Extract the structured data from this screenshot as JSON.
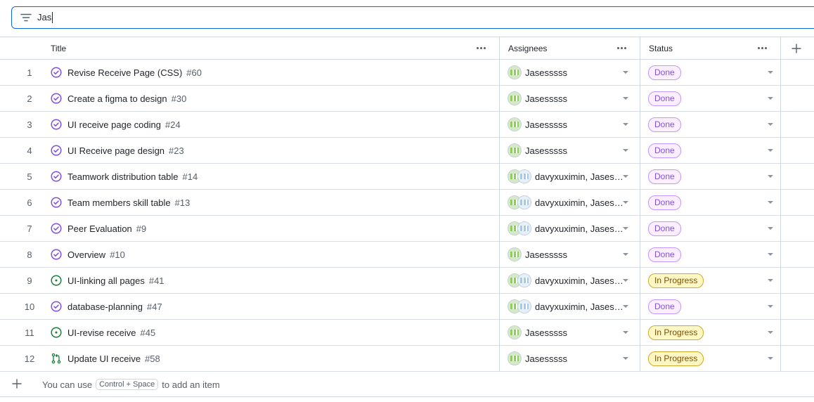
{
  "filter": {
    "value": "Jas",
    "icon": "filter-icon"
  },
  "columns": {
    "title": "Title",
    "assignees": "Assignees",
    "status": "Status"
  },
  "rows": [
    {
      "num": "1",
      "title": "Revise Receive Page (CSS)",
      "issue": "#60",
      "icon": "done",
      "assignee": "Jasesssss",
      "multi": false,
      "status": "Done"
    },
    {
      "num": "2",
      "title": "Create a figma to design",
      "issue": "#30",
      "icon": "done",
      "assignee": "Jasesssss",
      "multi": false,
      "status": "Done"
    },
    {
      "num": "3",
      "title": "UI receive page coding",
      "issue": "#24",
      "icon": "done",
      "assignee": "Jasesssss",
      "multi": false,
      "status": "Done"
    },
    {
      "num": "4",
      "title": "UI Receive page design",
      "issue": "#23",
      "icon": "done",
      "assignee": "Jasesssss",
      "multi": false,
      "status": "Done"
    },
    {
      "num": "5",
      "title": "Teamwork distribution table",
      "issue": "#14",
      "icon": "done",
      "assignee": "davyxuximin, Jasesssss",
      "multi": true,
      "status": "Done"
    },
    {
      "num": "6",
      "title": "Team members skill table",
      "issue": "#13",
      "icon": "done",
      "assignee": "davyxuximin, Jasesssss",
      "multi": true,
      "status": "Done"
    },
    {
      "num": "7",
      "title": "Peer Evaluation",
      "issue": "#9",
      "icon": "done",
      "assignee": "davyxuximin, Jasesssss",
      "multi": true,
      "status": "Done"
    },
    {
      "num": "8",
      "title": "Overview",
      "issue": "#10",
      "icon": "done",
      "assignee": "Jasesssss",
      "multi": false,
      "status": "Done"
    },
    {
      "num": "9",
      "title": "UI-linking all pages",
      "issue": "#41",
      "icon": "open",
      "assignee": "davyxuximin, Jasesssss",
      "multi": true,
      "status": "In Progress"
    },
    {
      "num": "10",
      "title": "database-planning",
      "issue": "#47",
      "icon": "done",
      "assignee": "davyxuximin, Jasesssss",
      "multi": true,
      "status": "Done"
    },
    {
      "num": "11",
      "title": "UI-revise receive",
      "issue": "#45",
      "icon": "open",
      "assignee": "Jasesssss",
      "multi": false,
      "status": "In Progress"
    },
    {
      "num": "12",
      "title": "Update UI receive",
      "issue": "#58",
      "icon": "pr",
      "assignee": "Jasesssss",
      "multi": false,
      "status": "In Progress"
    }
  ],
  "footer": {
    "prefix": "You can use",
    "shortcut": "Control + Space",
    "suffix": "to add an item"
  },
  "colors": {
    "done": "#8250df",
    "open": "#1a7f37",
    "accent": "#0969da"
  }
}
